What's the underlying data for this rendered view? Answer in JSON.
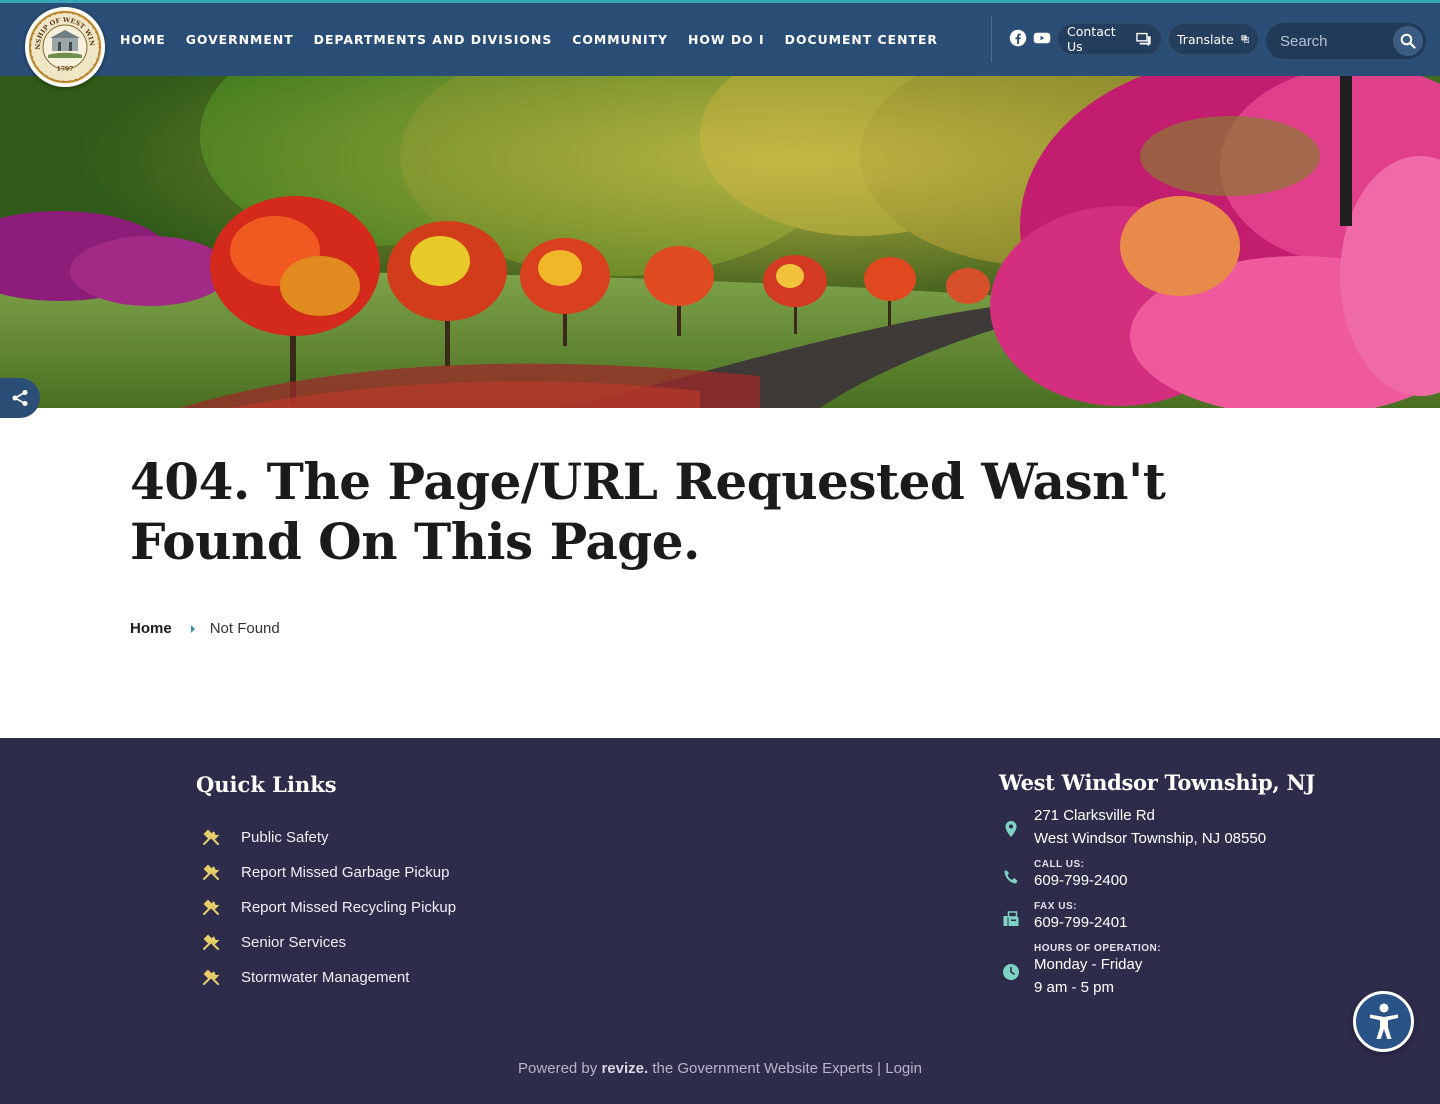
{
  "header": {
    "nav": [
      "HOME",
      "GOVERNMENT",
      "DEPARTMENTS AND DIVISIONS",
      "COMMUNITY",
      "HOW DO I",
      "DOCUMENT CENTER"
    ],
    "contact_label": "Contact Us",
    "translate_label": "Translate",
    "search_placeholder": "Search",
    "logo_text": "TOWNSHIP OF WEST WINDSOR",
    "logo_year": "1797"
  },
  "main": {
    "title": "404. The Page/URL Requested Wasn't Found On This Page.",
    "breadcrumb": {
      "home": "Home",
      "current": "Not Found"
    }
  },
  "footer": {
    "quick_links_title": "Quick Links",
    "quick_links": [
      "Public Safety",
      "Report Missed Garbage Pickup",
      "Report Missed Recycling Pickup",
      "Senior Services",
      "Stormwater Management"
    ],
    "town_title": "West Windsor Township, NJ",
    "address_line1": "271 Clarksville Rd",
    "address_line2": "West Windsor Township, NJ 08550",
    "call_label": "CALL US:",
    "phone": "609-799-2400",
    "fax_label": "FAX US:",
    "fax": "609-799-2401",
    "hours_label": "HOURS OF OPERATION:",
    "hours_days": "Monday - Friday",
    "hours_time": "9 am - 5 pm",
    "powered_prefix": "Powered by",
    "powered_brand": "revize.",
    "powered_suffix": "the Government Website Experts",
    "powered_sep": "|",
    "login": "Login"
  },
  "colors": {
    "header_bg": "#2a4e76",
    "accent_line": "#3aa7b9",
    "footer_bg": "#2e2c4b",
    "quicklink_icon": "#e6cf6a",
    "contact_icon": "#7fd3c4"
  }
}
